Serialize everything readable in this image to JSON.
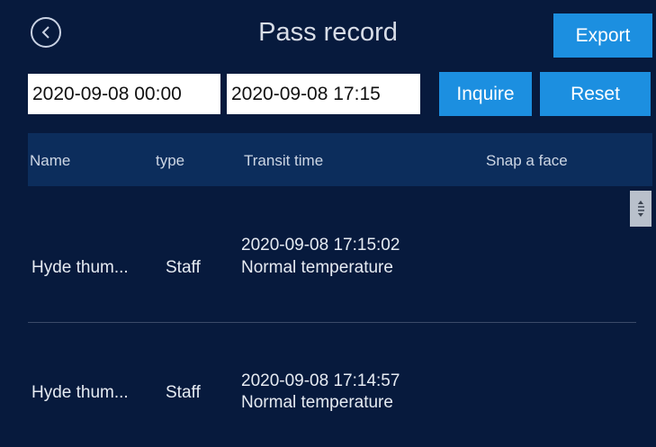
{
  "header": {
    "title": "Pass record",
    "export_label": "Export"
  },
  "filters": {
    "start_datetime": "2020-09-08 00:00",
    "end_datetime": "2020-09-08 17:15",
    "inquire_label": "Inquire",
    "reset_label": "Reset"
  },
  "table": {
    "columns": [
      "Name",
      "type",
      "Transit time",
      "Snap a face"
    ],
    "rows": [
      {
        "name": "Hyde thum...",
        "type": "Staff",
        "transit_time": "2020-09-08 17:15:02",
        "temperature": "Normal temperature"
      },
      {
        "name": "Hyde thum...",
        "type": "Staff",
        "transit_time": "2020-09-08 17:14:57",
        "temperature": "Normal temperature"
      }
    ]
  },
  "icons": {
    "back": "chevron-left-circle-icon",
    "scrollbar": "scroll-thumb-icon"
  },
  "colors": {
    "background": "#071a3d",
    "header_row": "#0c2d5c",
    "button": "#1c8fe0"
  }
}
